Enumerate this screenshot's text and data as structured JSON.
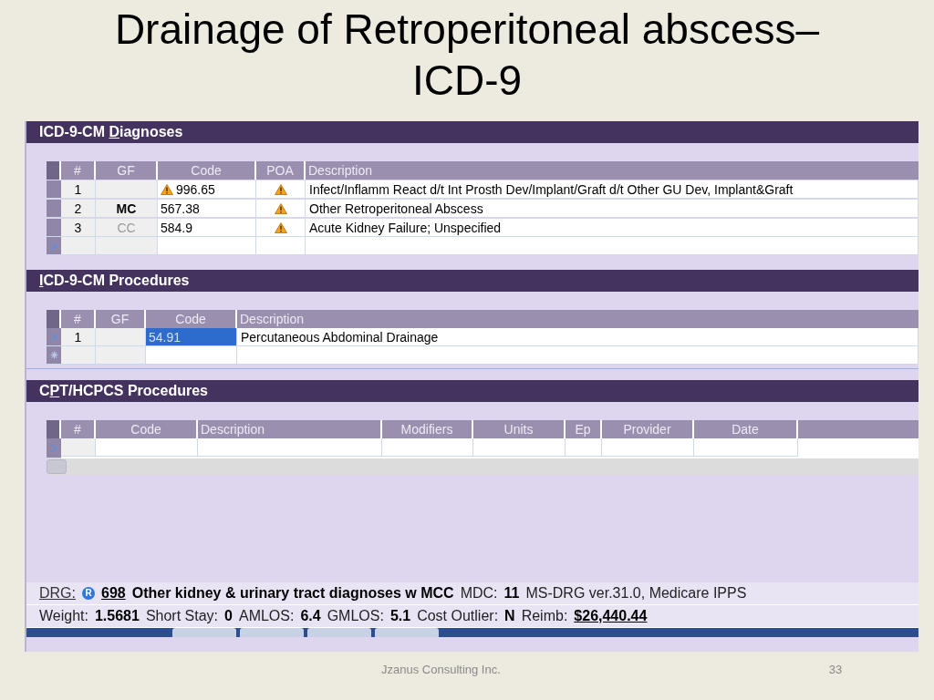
{
  "slide": {
    "title_lines": [
      "Drainage of Retroperitoneal abscess–",
      "ICD-9"
    ],
    "footer": "Jzanus Consulting Inc.",
    "page_number": "33"
  },
  "diagnoses": {
    "title": {
      "before": "ICD-9-CM ",
      "key": "D",
      "after": "iagnoses"
    },
    "columns": [
      "#",
      "GF",
      "Code",
      "POA",
      "Description"
    ],
    "rows": [
      {
        "number": "1",
        "code": "996.65",
        "code_warning": true,
        "poa_warning": true,
        "description": "Infect/Inflamm React d/t Int Prosth Dev/Implant/Graft d/t Other GU Dev, Implant&Graft"
      },
      {
        "number": "2",
        "gf": "MC",
        "gf_active": true,
        "code": "567.38",
        "code_warning": false,
        "poa_warning": true,
        "description": "Other Retroperitoneal Abscess"
      },
      {
        "number": "3",
        "gf": "CC",
        "gf_active": false,
        "code": "584.9",
        "code_warning": false,
        "poa_warning": true,
        "description": "Acute Kidney Failure; Unspecified"
      }
    ]
  },
  "procedures": {
    "title": {
      "key": "I",
      "after": "CD-9-CM Procedures"
    },
    "columns": [
      "#",
      "GF",
      "Code",
      "Description"
    ],
    "rows": [
      {
        "number": "1",
        "code": "54.91",
        "code_selected": true,
        "current": true,
        "description": "Percutaneous Abdominal Drainage"
      }
    ]
  },
  "cpt": {
    "title": {
      "before": "C",
      "key": "P",
      "after": "T/HCPCS Procedures"
    },
    "columns": [
      "#",
      "Code",
      "Description",
      "Modifiers",
      "Units",
      "Ep",
      "Provider",
      "Date"
    ]
  },
  "status": {
    "drg_line": [
      {
        "kind": "link",
        "text": "DRG:"
      },
      {
        "kind": "badge",
        "text": "R"
      },
      {
        "kind": "bold_link",
        "text": "698"
      },
      {
        "kind": "bold",
        "text": "Other kidney & urinary tract diagnoses w MCC"
      },
      {
        "kind": "label",
        "text": "MDC:"
      },
      {
        "kind": "bold",
        "text": "11"
      },
      {
        "kind": "label",
        "text": "MS-DRG ver.31.0, Medicare IPPS"
      }
    ],
    "weight_line": [
      {
        "kind": "label",
        "text": "Weight:"
      },
      {
        "kind": "bold",
        "text": "1.5681"
      },
      {
        "kind": "label",
        "text": "Short Stay:"
      },
      {
        "kind": "bold",
        "text": "0"
      },
      {
        "kind": "label",
        "text": "AMLOS:"
      },
      {
        "kind": "bold",
        "text": "6.4"
      },
      {
        "kind": "label",
        "text": "GMLOS:"
      },
      {
        "kind": "bold",
        "text": "5.1"
      },
      {
        "kind": "label",
        "text": "Cost Outlier:"
      },
      {
        "kind": "bold",
        "text": "N"
      },
      {
        "kind": "label",
        "text": "Reimb:"
      },
      {
        "kind": "bold_link",
        "text": "$26,440.44"
      }
    ]
  }
}
